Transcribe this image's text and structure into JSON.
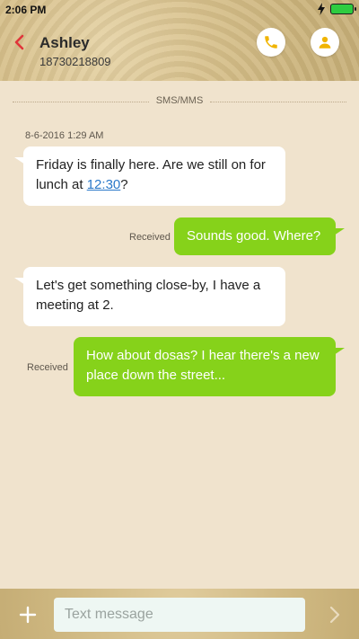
{
  "status_bar": {
    "time": "2:06 PM"
  },
  "header": {
    "contact_name": "Ashley",
    "contact_number": "18730218809",
    "accent_color": "#e0353a",
    "icon_color": "#f0b400"
  },
  "thread": {
    "divider_label": "SMS/MMS",
    "timestamp": "8-6-2016 1:29 AM",
    "messages": [
      {
        "direction": "incoming",
        "text_before_link": "Friday is finally here. Are we still on for lunch at ",
        "link": "12:30",
        "text_after_link": "?"
      },
      {
        "direction": "outgoing",
        "status": "Received",
        "text": "Sounds good. Where?"
      },
      {
        "direction": "incoming",
        "text": "Let's get something close-by, I have a meeting at 2."
      },
      {
        "direction": "outgoing",
        "status": "Received",
        "text": "How about dosas? I hear there's a new place down the street..."
      }
    ]
  },
  "composer": {
    "placeholder": "Text message",
    "value": ""
  },
  "colors": {
    "outgoing_bubble": "#86d21a",
    "incoming_bubble": "#ffffff",
    "background": "#f0e3cd"
  }
}
